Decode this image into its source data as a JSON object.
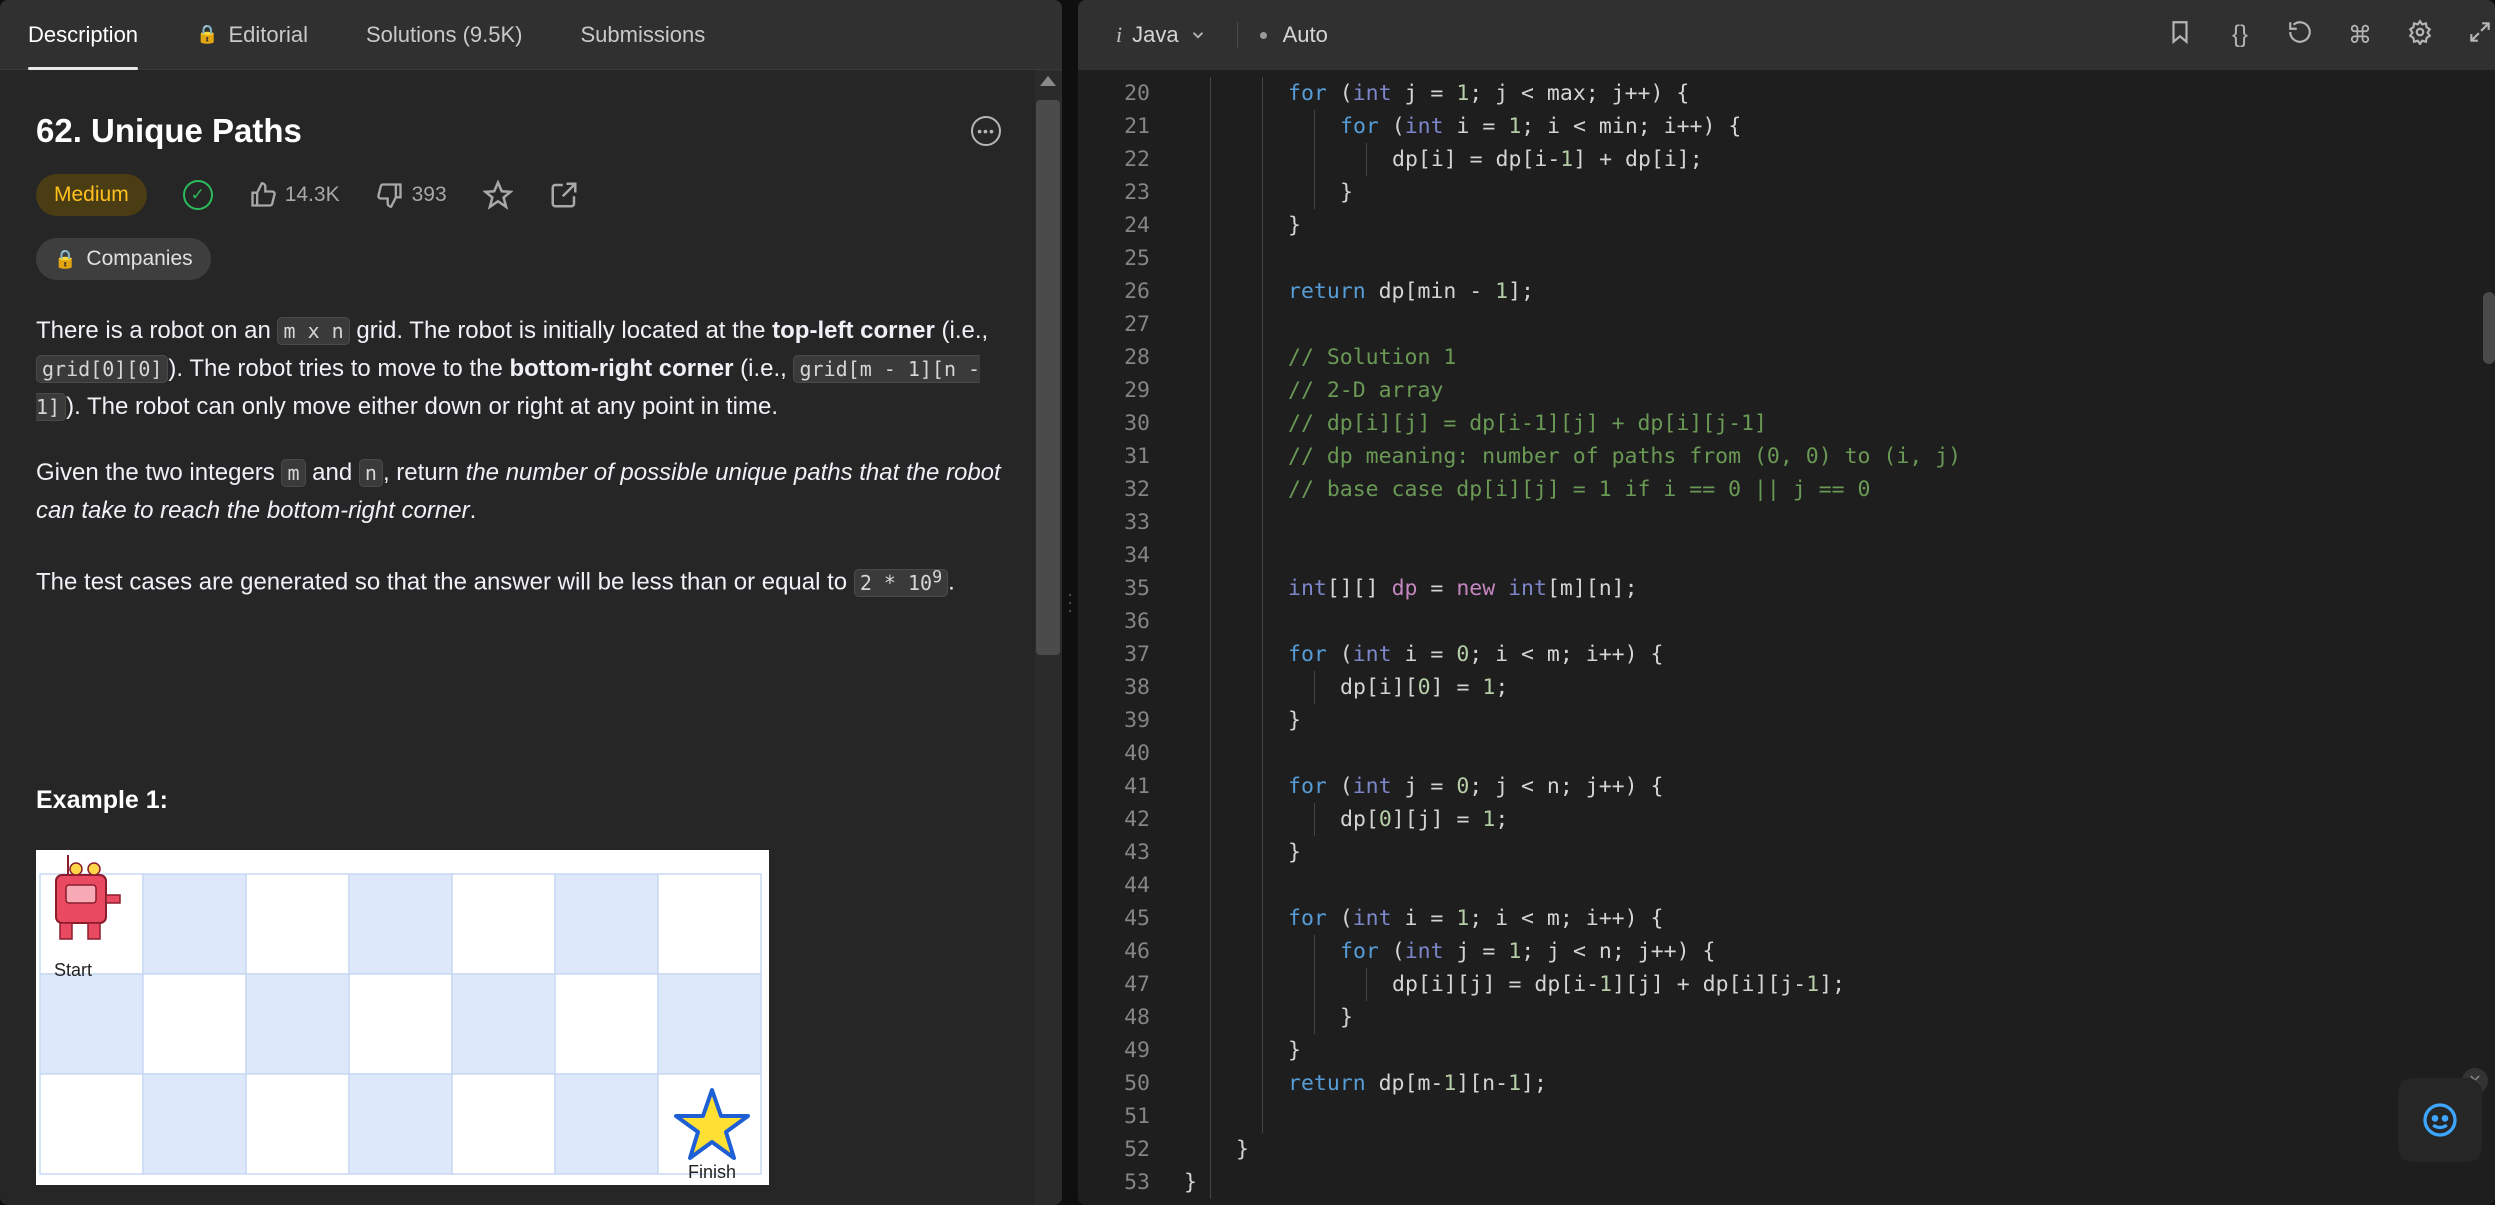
{
  "tabs": [
    {
      "label": "Description",
      "active": true
    },
    {
      "label": "Editorial",
      "locked": true
    },
    {
      "label": "Solutions (9.5K)"
    },
    {
      "label": "Submissions"
    }
  ],
  "problem": {
    "title": "62. Unique Paths",
    "difficulty": "Medium",
    "likes": "14.3K",
    "dislikes": "393",
    "companies_label": "Companies",
    "example_title": "Example 1:",
    "start_label": "Start",
    "finish_label": "Finish"
  },
  "desc": {
    "p1_a": "There is a robot on an ",
    "p1_code1": "m x n",
    "p1_b": " grid. The robot is initially located at the ",
    "p1_bold1": "top-left corner",
    "p1_c": " (i.e., ",
    "p1_code2": "grid[0][0]",
    "p1_d": "). The robot tries to move to the ",
    "p1_bold2": "bottom-right corner",
    "p1_e": " (i.e., ",
    "p1_code3": "grid[m - 1][n - 1]",
    "p1_f": "). The robot can only move either down or right at any point in time.",
    "p2_a": "Given the two integers ",
    "p2_code1": "m",
    "p2_b": " and ",
    "p2_code2": "n",
    "p2_c": ", return ",
    "p2_italic": "the number of possible unique paths that the robot can take to reach the bottom-right corner",
    "p2_d": ".",
    "p3_a": "The test cases are generated so that the answer will be less than or equal to ",
    "p3_code1": "2 * 10",
    "p3_sup": "9",
    "p3_b": "."
  },
  "editor": {
    "language": "Java",
    "mode": "Auto"
  },
  "code_lines": [
    {
      "n": "20",
      "indent": 2,
      "parts": [
        [
          "kw",
          "for"
        ],
        [
          "p",
          " ("
        ],
        [
          "ty",
          "int"
        ],
        [
          "p",
          " j = "
        ],
        [
          "num",
          "1"
        ],
        [
          "p",
          "; j < max; j++) {"
        ]
      ]
    },
    {
      "n": "21",
      "indent": 3,
      "parts": [
        [
          "kw",
          "for"
        ],
        [
          "p",
          " ("
        ],
        [
          "ty",
          "int"
        ],
        [
          "p",
          " i = "
        ],
        [
          "num",
          "1"
        ],
        [
          "p",
          "; i < min; i++) {"
        ]
      ]
    },
    {
      "n": "22",
      "indent": 4,
      "parts": [
        [
          "p",
          "dp[i] = dp[i-"
        ],
        [
          "num",
          "1"
        ],
        [
          "p",
          "] + dp[i];"
        ]
      ]
    },
    {
      "n": "23",
      "indent": 3,
      "parts": [
        [
          "p",
          "}"
        ]
      ]
    },
    {
      "n": "24",
      "indent": 2,
      "parts": [
        [
          "p",
          "}"
        ]
      ]
    },
    {
      "n": "25",
      "indent": 0,
      "parts": []
    },
    {
      "n": "26",
      "indent": 2,
      "parts": [
        [
          "kw",
          "return"
        ],
        [
          "p",
          " dp[min - "
        ],
        [
          "num",
          "1"
        ],
        [
          "p",
          "];"
        ]
      ]
    },
    {
      "n": "27",
      "indent": 0,
      "parts": []
    },
    {
      "n": "28",
      "indent": 2,
      "parts": [
        [
          "cm",
          "// Solution 1"
        ]
      ]
    },
    {
      "n": "29",
      "indent": 2,
      "parts": [
        [
          "cm",
          "// 2-D array"
        ]
      ]
    },
    {
      "n": "30",
      "indent": 2,
      "parts": [
        [
          "cm",
          "// dp[i][j] = dp[i-1][j] + dp[i][j-1]"
        ]
      ]
    },
    {
      "n": "31",
      "indent": 2,
      "parts": [
        [
          "cm",
          "// dp meaning: number of paths from (0, 0) to (i, j)"
        ]
      ]
    },
    {
      "n": "32",
      "indent": 2,
      "parts": [
        [
          "cm",
          "// base case dp[i][j] = 1 if i == 0 || j == 0"
        ]
      ]
    },
    {
      "n": "33",
      "indent": 0,
      "parts": []
    },
    {
      "n": "34",
      "indent": 0,
      "parts": []
    },
    {
      "n": "35",
      "indent": 2,
      "parts": [
        [
          "ty",
          "int"
        ],
        [
          "p",
          "[][] "
        ],
        [
          "new",
          "dp"
        ],
        [
          "p",
          " = "
        ],
        [
          "new",
          "new"
        ],
        [
          "p",
          " "
        ],
        [
          "ty",
          "int"
        ],
        [
          "p",
          "[m][n];"
        ]
      ]
    },
    {
      "n": "36",
      "indent": 0,
      "parts": []
    },
    {
      "n": "37",
      "indent": 2,
      "parts": [
        [
          "kw",
          "for"
        ],
        [
          "p",
          " ("
        ],
        [
          "ty",
          "int"
        ],
        [
          "p",
          " i = "
        ],
        [
          "num",
          "0"
        ],
        [
          "p",
          "; i < m; i++) {"
        ]
      ]
    },
    {
      "n": "38",
      "indent": 3,
      "parts": [
        [
          "p",
          "dp[i]["
        ],
        [
          "num",
          "0"
        ],
        [
          "p",
          "] = "
        ],
        [
          "num",
          "1"
        ],
        [
          "p",
          ";"
        ]
      ]
    },
    {
      "n": "39",
      "indent": 2,
      "parts": [
        [
          "p",
          "}"
        ]
      ]
    },
    {
      "n": "40",
      "indent": 0,
      "parts": []
    },
    {
      "n": "41",
      "indent": 2,
      "parts": [
        [
          "kw",
          "for"
        ],
        [
          "p",
          " ("
        ],
        [
          "ty",
          "int"
        ],
        [
          "p",
          " j = "
        ],
        [
          "num",
          "0"
        ],
        [
          "p",
          "; j < n; j++) {"
        ]
      ]
    },
    {
      "n": "42",
      "indent": 3,
      "parts": [
        [
          "p",
          "dp["
        ],
        [
          "num",
          "0"
        ],
        [
          "p",
          "][j] = "
        ],
        [
          "num",
          "1"
        ],
        [
          "p",
          ";"
        ]
      ]
    },
    {
      "n": "43",
      "indent": 2,
      "parts": [
        [
          "p",
          "}"
        ]
      ]
    },
    {
      "n": "44",
      "indent": 0,
      "parts": []
    },
    {
      "n": "45",
      "indent": 2,
      "parts": [
        [
          "kw",
          "for"
        ],
        [
          "p",
          " ("
        ],
        [
          "ty",
          "int"
        ],
        [
          "p",
          " i = "
        ],
        [
          "num",
          "1"
        ],
        [
          "p",
          "; i < m; i++) {"
        ]
      ]
    },
    {
      "n": "46",
      "indent": 3,
      "parts": [
        [
          "kw",
          "for"
        ],
        [
          "p",
          " ("
        ],
        [
          "ty",
          "int"
        ],
        [
          "p",
          " j = "
        ],
        [
          "num",
          "1"
        ],
        [
          "p",
          "; j < n; j++) {"
        ]
      ]
    },
    {
      "n": "47",
      "indent": 4,
      "parts": [
        [
          "p",
          "dp[i][j] = dp[i-"
        ],
        [
          "num",
          "1"
        ],
        [
          "p",
          "][j] + dp[i][j-"
        ],
        [
          "num",
          "1"
        ],
        [
          "p",
          "];"
        ]
      ]
    },
    {
      "n": "48",
      "indent": 3,
      "parts": [
        [
          "p",
          "}"
        ]
      ]
    },
    {
      "n": "49",
      "indent": 2,
      "parts": [
        [
          "p",
          "}"
        ]
      ]
    },
    {
      "n": "50",
      "indent": 2,
      "parts": [
        [
          "kw",
          "return"
        ],
        [
          "p",
          " dp[m-"
        ],
        [
          "num",
          "1"
        ],
        [
          "p",
          "][n-"
        ],
        [
          "num",
          "1"
        ],
        [
          "p",
          "];"
        ]
      ]
    },
    {
      "n": "51",
      "indent": 0,
      "parts": []
    },
    {
      "n": "52",
      "indent": 1,
      "parts": [
        [
          "p",
          "}"
        ]
      ]
    },
    {
      "n": "53",
      "indent": 0,
      "parts": [
        [
          "p",
          "}"
        ]
      ]
    }
  ],
  "colors": {
    "medium": "#ffc01e",
    "accepted": "#2cbb5d",
    "keyword": "#569cd6",
    "comment": "#6a9955",
    "number": "#b5cea8"
  }
}
